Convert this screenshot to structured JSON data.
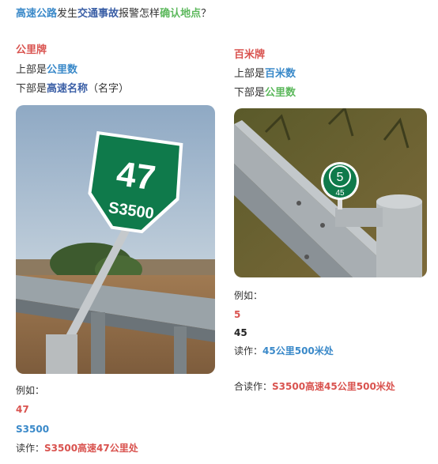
{
  "title": {
    "part1": "高速公路",
    "part2": "发生",
    "part3": "交通事故",
    "part4": "报警怎样",
    "part5": "确认地点",
    "part6": "？"
  },
  "left": {
    "heading": "公里牌",
    "line1_prefix": "上部是",
    "line1_value": "公里数",
    "line2_prefix": "下部是",
    "line2_value": "高速名称",
    "line2_suffix": "（名字）",
    "sign_number": "47",
    "sign_code": "S3500",
    "example_label": "例如：",
    "example_value1": "47",
    "example_value2": "S3500",
    "read_label": "读作：",
    "read_value": "S3500高速47公里处"
  },
  "right": {
    "heading": "百米牌",
    "line1_prefix": "上部是",
    "line1_value": "百米数",
    "line2_prefix": "下部是",
    "line2_value": "公里数",
    "sign_top": "5",
    "sign_bottom": "45",
    "example_label": "例如：",
    "example_value1": "5",
    "example_value2": "45",
    "read_label": "读作：",
    "read_value": "45公里500米处",
    "combined_label": "合读作：",
    "combined_value": "S3500高速45公里500米处"
  },
  "colors": {
    "blue": "#3a89c9",
    "dark_blue": "#3b5fa6",
    "green": "#5cb85c",
    "red": "#d9534f",
    "sign_green": "#0f7a4b"
  }
}
